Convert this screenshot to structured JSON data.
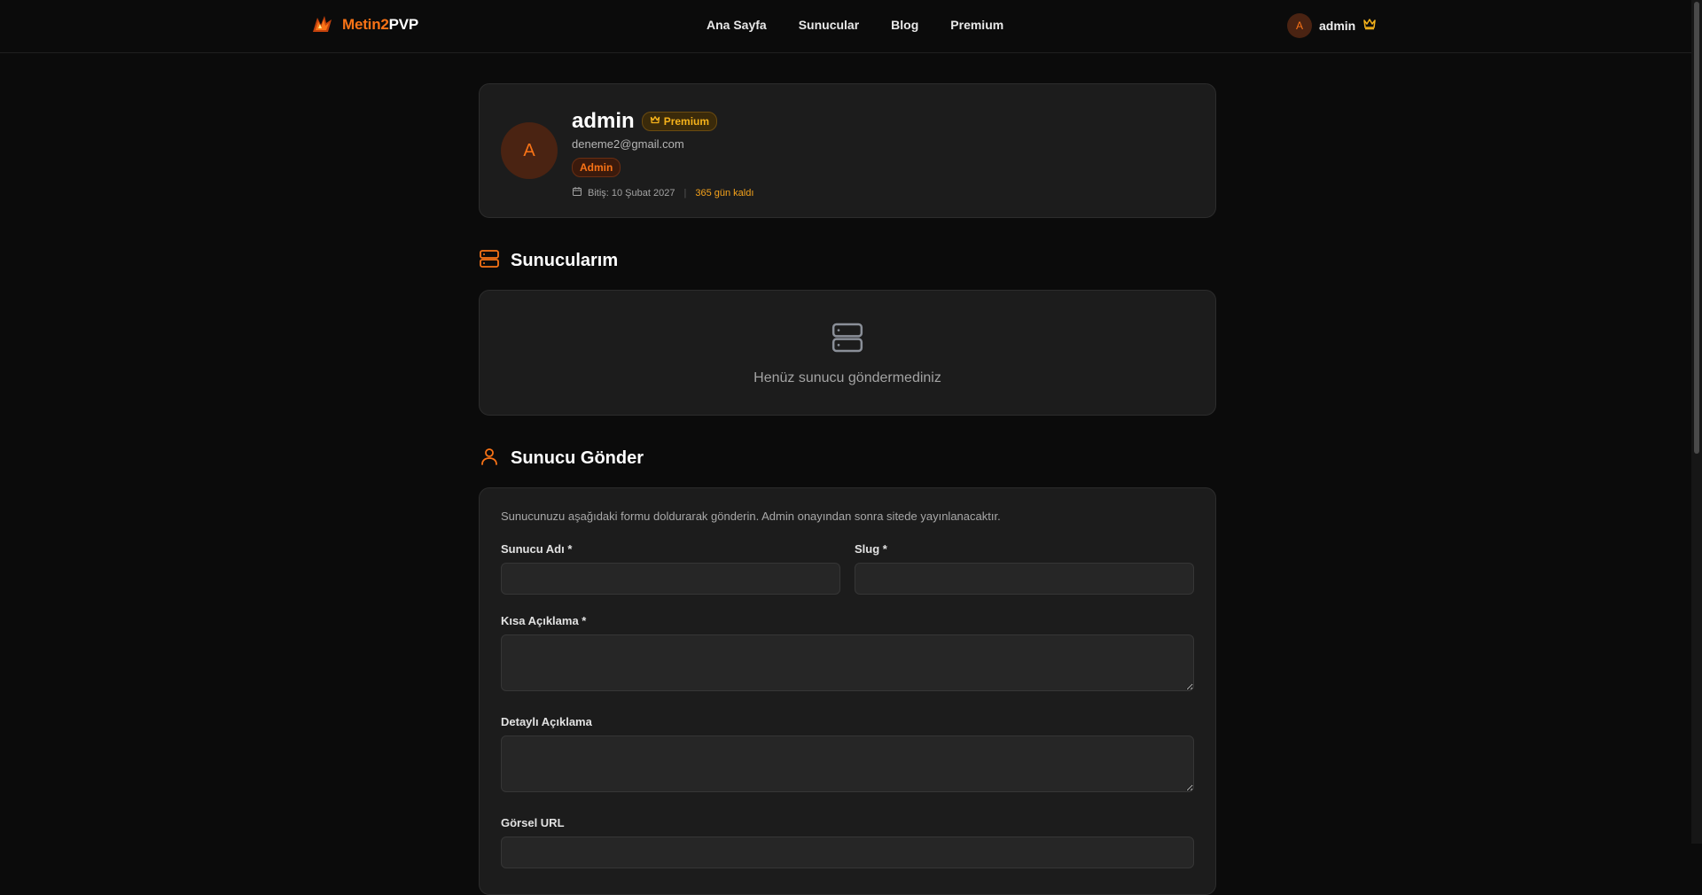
{
  "brand": {
    "part1": "Metin2",
    "part2": "PVP"
  },
  "nav": [
    {
      "label": "Ana Sayfa"
    },
    {
      "label": "Sunucular"
    },
    {
      "label": "Blog"
    },
    {
      "label": "Premium"
    }
  ],
  "user": {
    "initial": "A",
    "name": "admin"
  },
  "profile": {
    "initial": "A",
    "name": "admin",
    "premium_badge": "Premium",
    "email": "deneme2@gmail.com",
    "role_badge": "Admin",
    "expiry": "Bitiş: 10 Şubat 2027",
    "days_left": "365 gün kaldı"
  },
  "servers_section": {
    "title": "Sunucularım",
    "empty_text": "Henüz sunucu göndermediniz"
  },
  "submit_section": {
    "title": "Sunucu Gönder",
    "intro": "Sunucunuzu aşağıdaki formu doldurarak gönderin. Admin onayından sonra sitede yayınlanacaktır.",
    "fields": {
      "name_label": "Sunucu Adı *",
      "name_value": "",
      "slug_label": "Slug *",
      "slug_value": "",
      "short_desc_label": "Kısa Açıklama *",
      "short_desc_value": "",
      "long_desc_label": "Detaylı Açıklama",
      "long_desc_value": "",
      "image_url_label": "Görsel URL"
    }
  },
  "colors": {
    "accent": "#f97316",
    "premium": "#f5b21b",
    "background": "#0b0b0b",
    "card": "#1c1c1c"
  }
}
